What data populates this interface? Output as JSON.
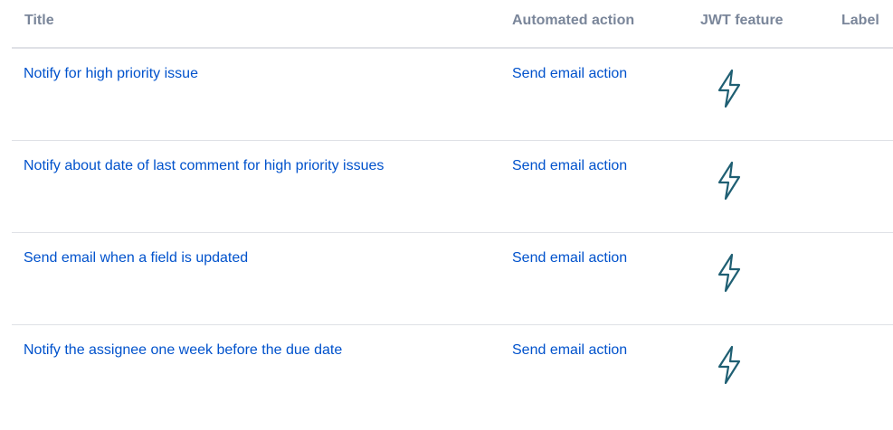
{
  "table": {
    "headers": {
      "title": "Title",
      "automated_action": "Automated action",
      "jwt_feature": "JWT feature",
      "label": "Label"
    },
    "rows": [
      {
        "title": "Notify for high priority issue",
        "action": "Send email action",
        "feature_icon": "lightning-bolt-icon",
        "label": ""
      },
      {
        "title": "Notify about date of last comment for high priority issues",
        "action": "Send email action",
        "feature_icon": "lightning-bolt-icon",
        "label": ""
      },
      {
        "title": "Send email when a field is updated",
        "action": "Send email action",
        "feature_icon": "lightning-bolt-icon",
        "label": ""
      },
      {
        "title": "Notify the assignee one week before the due date",
        "action": "Send email action",
        "feature_icon": "lightning-bolt-icon",
        "label": ""
      }
    ]
  },
  "colors": {
    "link": "#0052cc",
    "header_text": "#7a869a",
    "icon_stroke": "#1f5f73",
    "divider": "#dfe1e6"
  }
}
